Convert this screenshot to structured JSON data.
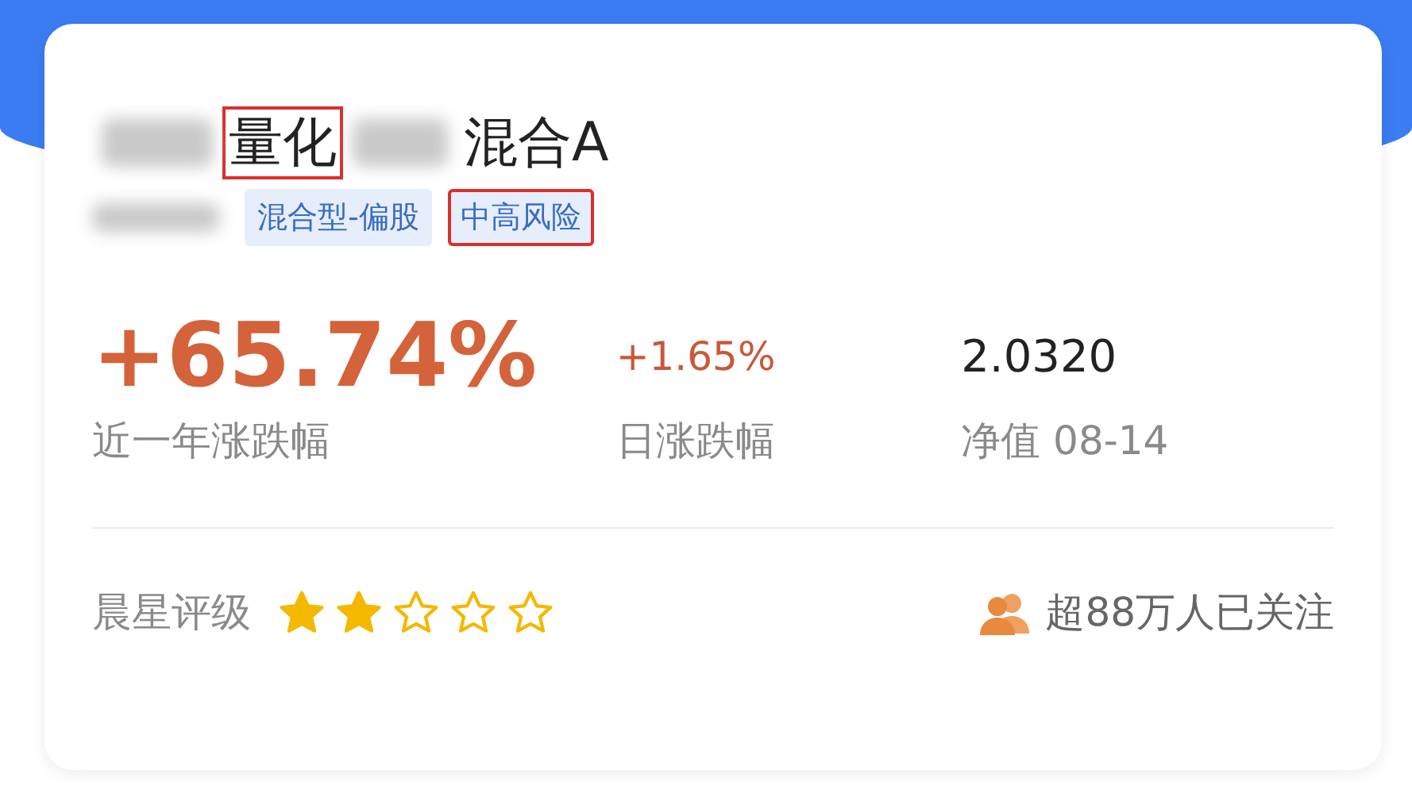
{
  "fund": {
    "name_parts": [
      {
        "kind": "blur"
      },
      {
        "kind": "text",
        "text": "量化",
        "highlighted": true
      },
      {
        "kind": "blur"
      },
      {
        "kind": "text",
        "text": "混合A",
        "highlighted": false
      }
    ],
    "tag_row": [
      {
        "kind": "blur"
      },
      {
        "kind": "tag",
        "text": "混合型-偏股",
        "highlighted": false
      },
      {
        "kind": "tag",
        "text": "中高风险",
        "highlighted": true
      }
    ],
    "stats": [
      {
        "kind": "big",
        "value": "+65.74%",
        "label": "近一年涨跌幅"
      },
      {
        "kind": "rise",
        "value": "+1.65%",
        "label": "日涨跌幅"
      },
      {
        "kind": "plain",
        "value": "2.0320",
        "label": "净值 08-14"
      }
    ],
    "rating": {
      "label": "晨星评级",
      "stars": 2
    },
    "followers": "超88万人已关注"
  }
}
